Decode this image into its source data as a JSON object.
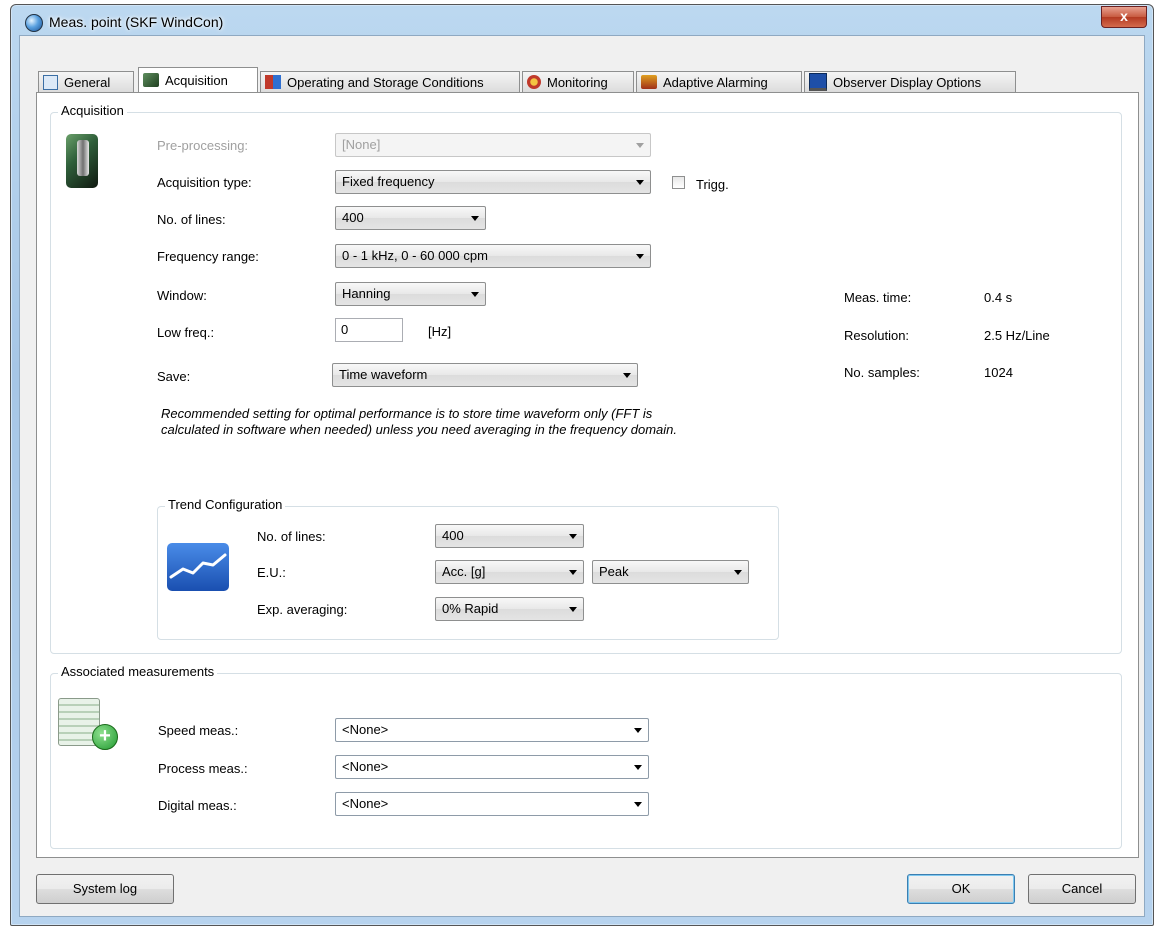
{
  "window": {
    "title": "Meas. point (SKF WindCon)",
    "close_label": "x"
  },
  "tabs": [
    {
      "label": "General"
    },
    {
      "label": "Acquisition"
    },
    {
      "label": "Operating and Storage Conditions"
    },
    {
      "label": "Monitoring"
    },
    {
      "label": "Adaptive Alarming"
    },
    {
      "label": "Observer Display Options"
    }
  ],
  "acquisition": {
    "group_title": "Acquisition",
    "preprocessing": {
      "label": "Pre-processing:",
      "value": "[None]"
    },
    "acq_type": {
      "label": "Acquisition type:",
      "value": "Fixed frequency"
    },
    "trigg": {
      "label": "Trigg.",
      "checked": false
    },
    "lines": {
      "label": "No. of lines:",
      "value": "400"
    },
    "freq_range": {
      "label": "Frequency range:",
      "value": "0 - 1 kHz, 0 - 60 000 cpm"
    },
    "window": {
      "label": "Window:",
      "value": "Hanning"
    },
    "low_freq": {
      "label": "Low freq.:",
      "value": "0",
      "unit": "[Hz]"
    },
    "save": {
      "label": "Save:",
      "value": "Time waveform"
    },
    "note_line1": "Recommended setting for optimal performance is to store time waveform only (FFT is",
    "note_line2": "calculated in software when needed) unless you need averaging in the frequency domain.",
    "info": {
      "meas_time_label": "Meas. time:",
      "meas_time_value": "0.4 s",
      "resolution_label": "Resolution:",
      "resolution_value": "2.5 Hz/Line",
      "samples_label": "No. samples:",
      "samples_value": "1024"
    },
    "trend": {
      "group_title": "Trend Configuration",
      "lines_label": "No. of lines:",
      "lines_value": "400",
      "eu_label": "E.U.:",
      "eu_value": "Acc. [g]",
      "eu_type_value": "Peak",
      "exp_label": "Exp. averaging:",
      "exp_value": "0% Rapid"
    }
  },
  "associated": {
    "group_title": "Associated measurements",
    "speed": {
      "label": "Speed meas.:",
      "value": "<None>"
    },
    "process": {
      "label": "Process meas.:",
      "value": "<None>"
    },
    "digital": {
      "label": "Digital meas.:",
      "value": "<None>"
    }
  },
  "buttons": {
    "system_log": "System log",
    "ok": "OK",
    "cancel": "Cancel"
  },
  "colors": {
    "title_bar": "#a6c6e6",
    "close_button": "#c75a40",
    "trend_icon": "#2a64c4"
  }
}
